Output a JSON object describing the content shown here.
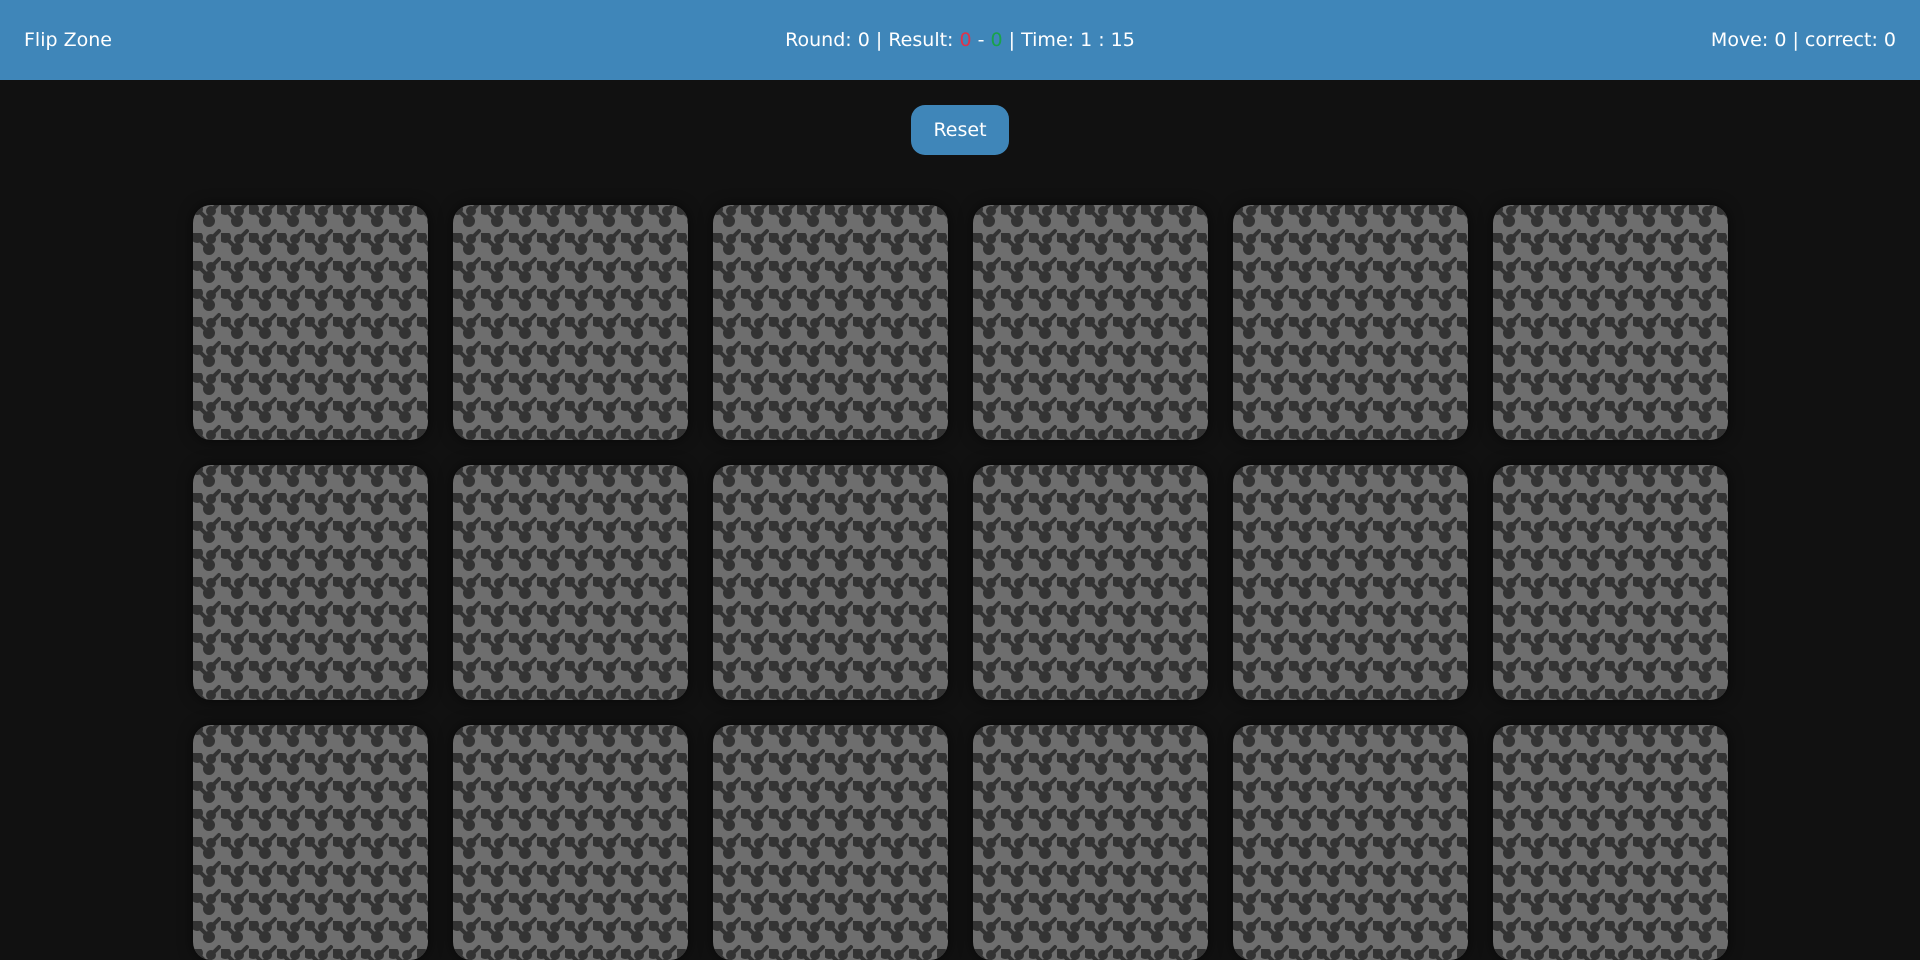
{
  "header": {
    "app_title": "Flip Zone",
    "round_label": "Round:",
    "round_value": "0",
    "separator": "|",
    "result_label": "Result:",
    "result_left": "0",
    "result_dash": "-",
    "result_right": "0",
    "time_label": "Time:",
    "time_value": "1 : 15",
    "move_label": "Move:",
    "move_value": "0",
    "correct_label": "correct:",
    "correct_value": "0"
  },
  "controls": {
    "reset_label": "Reset"
  },
  "board": {
    "rows_visible": 3,
    "columns": 6,
    "card_state": "face-down",
    "card_back_color": "#6e6e6e",
    "card_pattern_color": "#333333"
  },
  "colors": {
    "header_bg": "#3f86b9",
    "page_bg": "#111111",
    "result_left_color": "#e0324b",
    "result_right_color": "#19a34a"
  }
}
